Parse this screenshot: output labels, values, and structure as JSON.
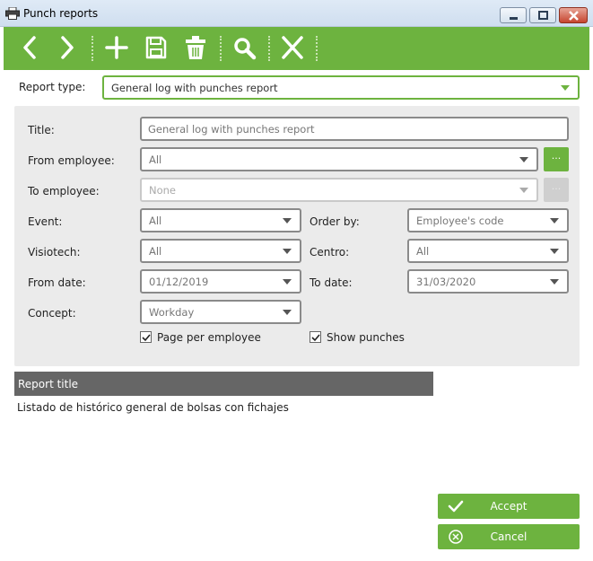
{
  "window": {
    "title": "Punch reports"
  },
  "toolbar": {
    "icons": [
      "chevron-left-icon",
      "chevron-right-icon",
      "plus-icon",
      "save-icon",
      "trash-icon",
      "search-icon",
      "close-icon"
    ]
  },
  "report_type": {
    "label": "Report type:",
    "value": "General log with punches report"
  },
  "filters": {
    "title": {
      "label": "Title:",
      "value": "General log with punches report"
    },
    "from_employee": {
      "label": "From employee:",
      "value": "All",
      "button": "..."
    },
    "to_employee": {
      "label": "To employee:",
      "value": "None",
      "button": "..."
    },
    "event": {
      "label": "Event:",
      "value": "All"
    },
    "order_by": {
      "label": "Order by:",
      "value": "Employee's code"
    },
    "visiotech": {
      "label": "Visiotech:",
      "value": "All"
    },
    "centro": {
      "label": "Centro:",
      "value": "All"
    },
    "from_date": {
      "label": "From date:",
      "value": "01/12/2019"
    },
    "to_date": {
      "label": "To date:",
      "value": "31/03/2020"
    },
    "concept": {
      "label": "Concept:",
      "value": "Workday"
    },
    "page_per_employee": {
      "label": "Page per employee",
      "checked": true
    },
    "show_punches": {
      "label": "Show punches",
      "checked": true
    }
  },
  "report_title": {
    "header": "Report title",
    "value": "Listado de histórico general de bolsas con fichajes"
  },
  "actions": {
    "accept": "Accept",
    "cancel": "Cancel"
  },
  "colors": {
    "accent": "#6db33f",
    "header_gray": "#666666",
    "panel": "#ebebeb"
  }
}
